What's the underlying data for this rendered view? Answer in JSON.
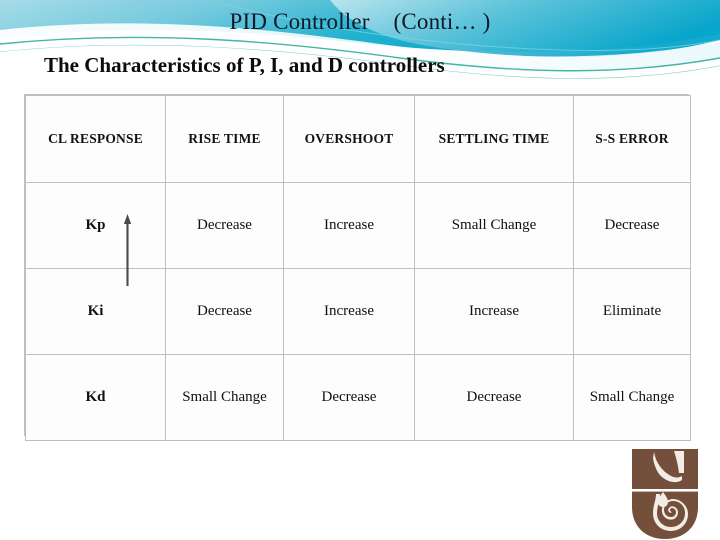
{
  "slide": {
    "title": "PID Controller    (Conti… )",
    "subtitle": "The Characteristics of P, I, and D controllers",
    "background_color": "#ffffff",
    "banner": {
      "name": "decorative-wave-banner",
      "colors": {
        "light_blue": "#8fd3e0",
        "mid_cyan": "#17b6cf",
        "deep_cyan": "#0aa5c4",
        "teal_line": "#2fae9b",
        "white": "#ffffff"
      }
    }
  },
  "table": {
    "name": "pid-characteristics-table",
    "border_color": "#bfbfbf",
    "headers": [
      "CL RESPONSE",
      "RISE TIME",
      "OVERSHOOT",
      "SETTLING TIME",
      "S-S ERROR"
    ],
    "rows": [
      {
        "label": "Kp",
        "cells": [
          "Decrease",
          "Increase",
          "Small Change",
          "Decrease"
        ]
      },
      {
        "label": "Ki",
        "cells": [
          "Decrease",
          "Increase",
          "Increase",
          "Eliminate"
        ]
      },
      {
        "label": "Kd",
        "cells": [
          "Small Change",
          "Decrease",
          "Decrease",
          "Small Change"
        ]
      }
    ]
  },
  "annotation": {
    "name": "up-arrow-annotation",
    "color": "#4a4a4a",
    "description": "Up arrow"
  },
  "logo": {
    "name": "university-logo",
    "color": "#74503c",
    "alt": "Logo"
  }
}
